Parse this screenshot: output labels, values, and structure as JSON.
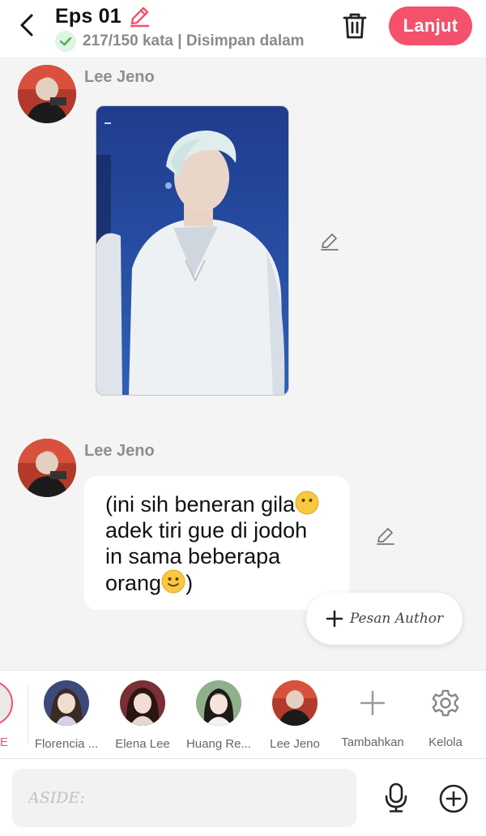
{
  "header": {
    "title": "Eps 01",
    "status": "217/150 kata | Disimpan dalam",
    "next_label": "Lanjut"
  },
  "messages": [
    {
      "sender": "Lee Jeno",
      "type": "image"
    },
    {
      "sender": "Lee Jeno",
      "type": "text",
      "lines": [
        "(ini sih beneran gila",
        "adek tiri gue di jodoh",
        "in sama beberapa",
        "orang",
        ")"
      ]
    }
  ],
  "author_button": {
    "label": "Pesan Author"
  },
  "characters": [
    {
      "name": "E"
    },
    {
      "name": "Florencia ..."
    },
    {
      "name": "Elena Lee"
    },
    {
      "name": "Huang Re..."
    },
    {
      "name": "Lee Jeno"
    }
  ],
  "tools": {
    "add_label": "Tambahkan",
    "manage_label": "Kelola"
  },
  "input": {
    "placeholder": "ASIDE:"
  },
  "colors": {
    "accent": "#f4516c",
    "success": "#4caf50",
    "background": "#f4f4f4"
  },
  "icons": [
    "back-icon",
    "pencil-icon",
    "check-icon",
    "trash-icon",
    "edit-icon",
    "plus-icon",
    "gear-icon",
    "mic-icon",
    "plus-circle-icon"
  ]
}
